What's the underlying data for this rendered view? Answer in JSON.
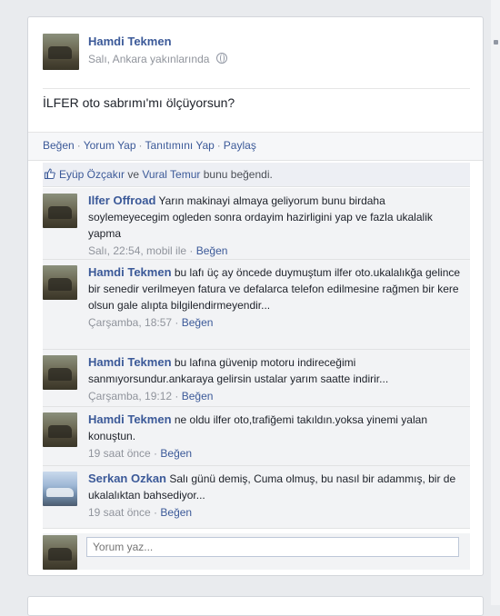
{
  "post": {
    "author": "Hamdi Tekmen",
    "meta": "Salı, Ankara yakınlarında",
    "text": "İLFER oto sabrımı'mı ölçüyorsun?"
  },
  "actions": [
    "Beğen",
    "Yorum Yap",
    "Tanıtımını Yap",
    "Paylaş"
  ],
  "likes": {
    "user1": "Eyüp Özçakır",
    "connector": " ve ",
    "user2": "Vural Temur",
    "suffix": " bunu beğendi."
  },
  "comments": [
    {
      "author": "Ilfer Offroad",
      "text": "Yarın makinayi almaya geliyorum bunu birdaha soylemeyecegim ogleden sonra ordayim hazirligini yap ve fazla ukalalik yapma",
      "time": "Salı, 22:54, mobil ile",
      "like": "Beğen"
    },
    {
      "author": "Hamdi Tekmen",
      "text": "bu lafı üç ay öncede duymuştum ilfer oto.ukalalıkğa gelince bir senedir verilmeyen fatura ve defalarca telefon edilmesine rağmen bir kere olsun gale alıpta bilgilendirmeyendir...",
      "time": "Çarşamba, 18:57",
      "like": "Beğen"
    },
    {
      "author": "Hamdi Tekmen",
      "text": "bu lafına güvenip motoru indireceğimi sanmıyorsundur.ankaraya gelirsin ustalar yarım saatte indirir...",
      "time": "Çarşamba, 19:12",
      "like": "Beğen"
    },
    {
      "author": "Hamdi Tekmen",
      "text": "ne oldu ilfer oto,trafiğemi takıldın.yoksa yinemi yalan konuştun.",
      "time": "19 saat önce",
      "like": "Beğen"
    },
    {
      "author": "Serkan Ozkan",
      "text": "Salı günü demiş, Cuma olmuş, bu nasıl bir adammış, bir de ukalalıktan bahsediyor...",
      "time": "19 saat önce",
      "like": "Beğen"
    }
  ],
  "write_comment": {
    "placeholder": "Yorum yaz..."
  },
  "colors": {
    "link": "#3b5998",
    "meta": "#90949c",
    "comment_bg": "#f2f3f5"
  }
}
